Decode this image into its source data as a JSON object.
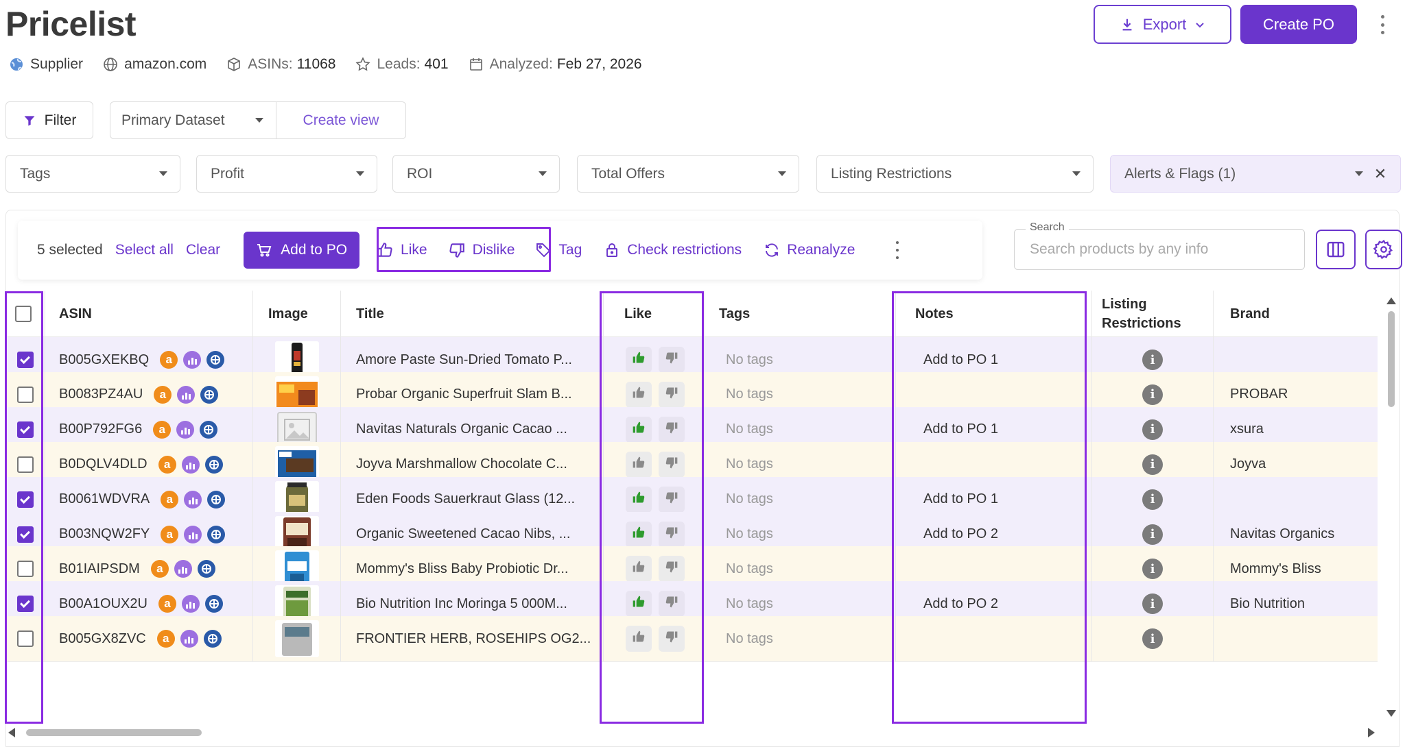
{
  "page": {
    "title": "Pricelist",
    "meta": {
      "supplier": "Supplier",
      "domain": "amazon.com",
      "asins_label": "ASINs:",
      "asins_value": "11068",
      "leads_label": "Leads:",
      "leads_value": "401",
      "analyzed_label": "Analyzed:",
      "analyzed_value": "Feb 27, 2026"
    },
    "export_label": "Export",
    "create_po_label": "Create PO"
  },
  "filters": {
    "filter_label": "Filter",
    "dataset": "Primary Dataset",
    "create_view": "Create view",
    "chips": [
      "Tags",
      "Profit",
      "ROI",
      "Total Offers",
      "Listing Restrictions",
      "Alerts & Flags (1)"
    ]
  },
  "toolbar": {
    "selected_text": "5 selected",
    "select_all": "Select all",
    "clear": "Clear",
    "add_to_po": "Add to PO",
    "like": "Like",
    "dislike": "Dislike",
    "tag": "Tag",
    "check_restrictions": "Check restrictions",
    "reanalyze": "Reanalyze"
  },
  "search": {
    "label": "Search",
    "placeholder": "Search products by any info"
  },
  "table": {
    "headers": {
      "asin": "ASIN",
      "image": "Image",
      "title": "Title",
      "like": "Like",
      "tags": "Tags",
      "notes": "Notes",
      "listing_restrictions_line1": "Listing",
      "listing_restrictions_line2": "Restrictions",
      "brand": "Brand"
    },
    "rows": [
      {
        "asin": "B005GXEKBQ",
        "title": "Amore Paste Sun-Dried Tomato P...",
        "tags": "No tags",
        "notes": "Add to PO 1",
        "brand": "",
        "checked": true,
        "liked": true
      },
      {
        "asin": "B0083PZ4AU",
        "title": "Probar Organic Superfruit Slam B...",
        "tags": "No tags",
        "notes": "",
        "brand": "PROBAR",
        "checked": false,
        "liked": false
      },
      {
        "asin": "B00P792FG6",
        "title": "Navitas Naturals Organic Cacao ...",
        "tags": "No tags",
        "notes": "Add to PO 1",
        "brand": "xsura",
        "checked": true,
        "liked": true
      },
      {
        "asin": "B0DQLV4DLD",
        "title": "Joyva Marshmallow Chocolate C...",
        "tags": "No tags",
        "notes": "",
        "brand": "Joyva",
        "checked": false,
        "liked": false
      },
      {
        "asin": "B0061WDVRA",
        "title": "Eden Foods Sauerkraut Glass (12...",
        "tags": "No tags",
        "notes": "Add to PO 1",
        "brand": "",
        "checked": true,
        "liked": true
      },
      {
        "asin": "B003NQW2FY",
        "title": "Organic Sweetened Cacao Nibs, ...",
        "tags": "No tags",
        "notes": "Add to PO 2",
        "brand": "Navitas Organics",
        "checked": true,
        "liked": true
      },
      {
        "asin": "B01IAIPSDM",
        "title": "Mommy's Bliss Baby Probiotic Dr...",
        "tags": "No tags",
        "notes": "",
        "brand": "Mommy's Bliss",
        "checked": false,
        "liked": false
      },
      {
        "asin": "B00A1OUX2U",
        "title": "Bio Nutrition Inc Moringa 5 000M...",
        "tags": "No tags",
        "notes": "Add to PO 2",
        "brand": "Bio Nutrition",
        "checked": true,
        "liked": true
      },
      {
        "asin": "B005GX8ZVC",
        "title": "FRONTIER HERB, ROSEHIPS OG2...",
        "tags": "No tags",
        "notes": "",
        "brand": "",
        "checked": false,
        "liked": false
      }
    ]
  },
  "colors": {
    "accent": "#6a35cc",
    "highlight": "#8a2be2",
    "row_purple": "#f2eefb",
    "row_yellow": "#fdf8ea",
    "like_green": "#2e9b2e"
  }
}
